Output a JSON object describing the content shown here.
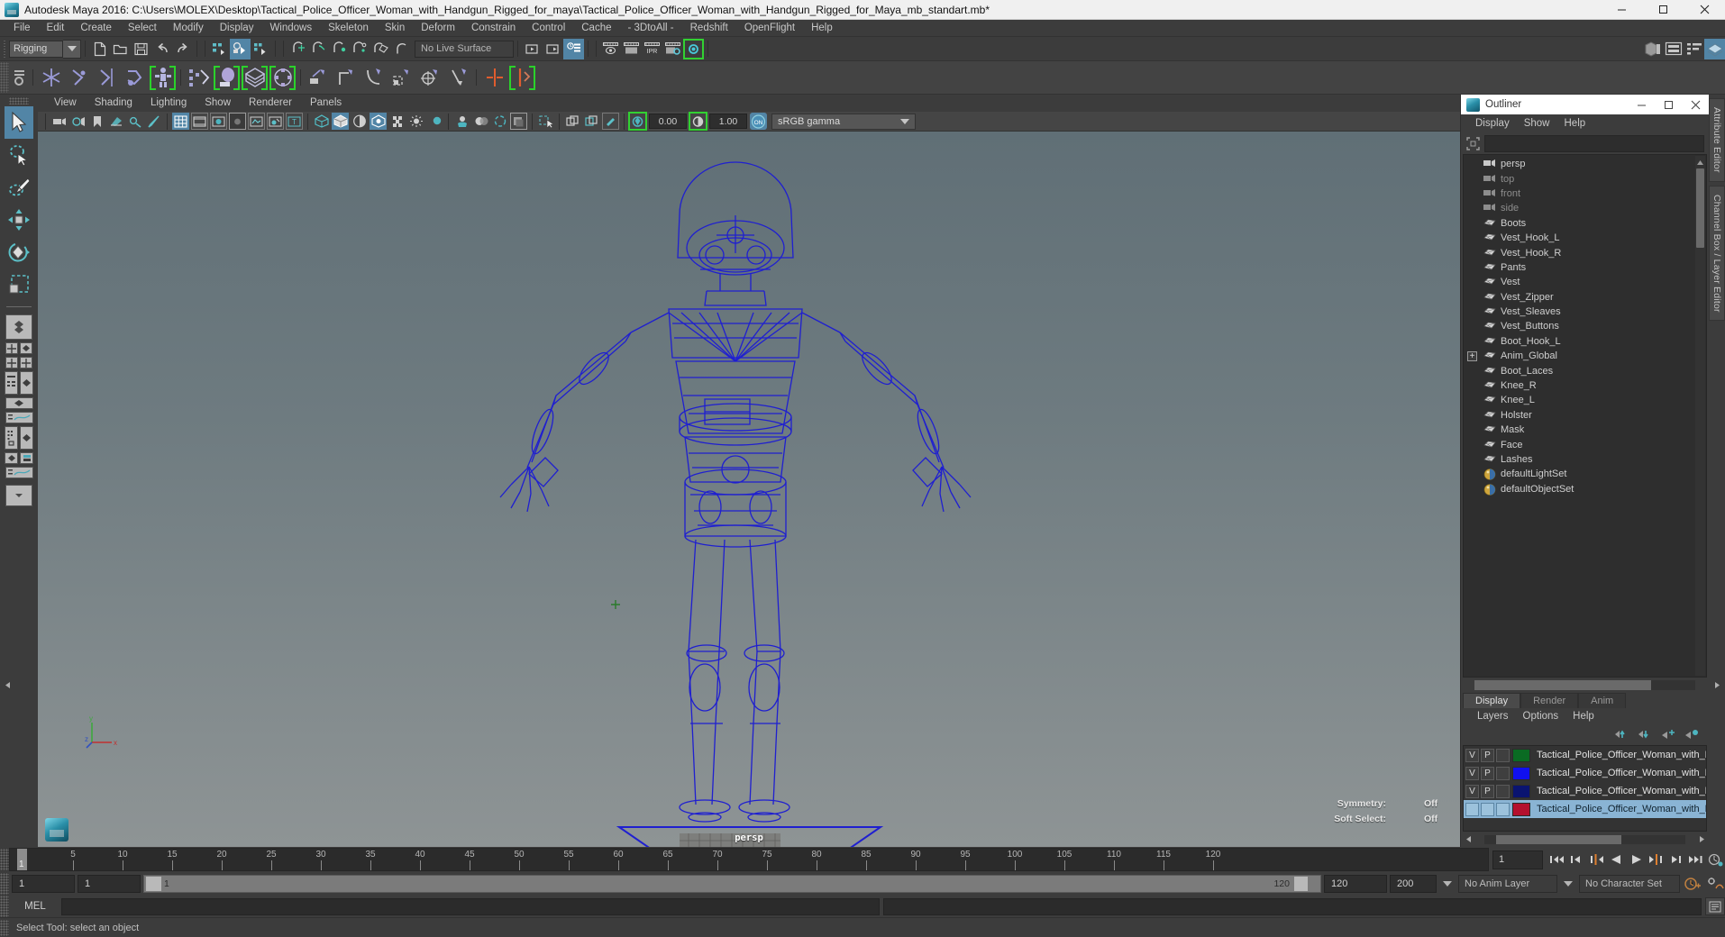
{
  "window": {
    "title": "Autodesk Maya 2016: C:\\Users\\MOLEX\\Desktop\\Tactical_Police_Officer_Woman_with_Handgun_Rigged_for_maya\\Tactical_Police_Officer_Woman_with_Handgun_Rigged_for_Maya_mb_standart.mb*",
    "minimize": "—",
    "maximize": "☐",
    "close": "✕"
  },
  "menubar": {
    "items": [
      "File",
      "Edit",
      "Create",
      "Select",
      "Modify",
      "Display",
      "Windows",
      "Skeleton",
      "Skin",
      "Deform",
      "Constrain",
      "Control",
      "Cache",
      "- 3DtoAll -",
      "Redshift",
      "OpenFlight",
      "Help"
    ]
  },
  "statusbar": {
    "menuset": "Rigging",
    "live_surface": "No Live Surface",
    "icons": [
      "new-scene-icon",
      "open-scene-icon",
      "save-scene-icon",
      "undo-icon",
      "redo-icon",
      "select-hierarchy-icon",
      "select-object-icon",
      "select-component-icon",
      "snap-grid-icon",
      "snap-curve-icon",
      "snap-point-icon",
      "snap-projected-icon",
      "snap-view-plane-icon",
      "make-live-icon",
      "open-editor-icon",
      "open-render-view-icon",
      "attribute-editor-toggle-icon",
      "render-current-frame-icon",
      "render-sequence-icon",
      "ipr-render-icon",
      "render-settings-icon",
      "toggle-render-region-icon",
      "show-channel-box-icon",
      "show-layer-editor-icon",
      "show-attribute-editor-icon",
      "show-tool-settings-icon"
    ]
  },
  "shelf": {
    "icons": [
      "joint-tool-icon",
      "ik-handle-tool-icon",
      "ik-spline-handle-icon",
      "insert-joint-tool-icon",
      "quick-rig-icon",
      "human-ik-icon",
      "bind-skin-icon",
      "interactive-bind-icon",
      "smooth-bind-icon",
      "parent-constraint-icon",
      "point-constraint-icon",
      "orient-constraint-icon",
      "scale-constraint-icon",
      "aim-constraint-icon",
      "pole-vector-constraint-icon",
      "mirror-joint-icon",
      "mirror-skin-weights-icon"
    ]
  },
  "toolbox": {
    "tools": [
      {
        "name": "select-tool",
        "selected": true
      },
      {
        "name": "lasso-select-tool",
        "selected": false
      },
      {
        "name": "paint-select-tool",
        "selected": false
      },
      {
        "name": "move-tool",
        "selected": false
      },
      {
        "name": "rotate-tool",
        "selected": false
      },
      {
        "name": "scale-tool",
        "selected": false
      }
    ],
    "layouts": [
      "single-perspective-layout",
      "four-view-layout",
      "outliner-persp-layout",
      "persp-graph-layout",
      "hypershade-persp-layout",
      "persp-graph-outliner-layout"
    ]
  },
  "viewport": {
    "menus": [
      "View",
      "Shading",
      "Lighting",
      "Show",
      "Renderer",
      "Panels"
    ],
    "exposure": "0.00",
    "gamma": "1.00",
    "color_management": "sRGB gamma",
    "camera_label": "persp",
    "hud": [
      {
        "label": "Symmetry:",
        "value": "Off"
      },
      {
        "label": "Soft Select:",
        "value": "Off"
      }
    ],
    "axes": {
      "y": "y",
      "x": "x",
      "z": "z"
    }
  },
  "outliner": {
    "title": "Outliner",
    "menus": [
      "Display",
      "Show",
      "Help"
    ],
    "search_value": "",
    "items": [
      {
        "label": "persp",
        "icon": "camera-icon",
        "type": "camera",
        "dim": false,
        "expandable": false
      },
      {
        "label": "top",
        "icon": "camera-icon",
        "type": "camera",
        "dim": true,
        "expandable": false
      },
      {
        "label": "front",
        "icon": "camera-icon",
        "type": "camera",
        "dim": true,
        "expandable": false
      },
      {
        "label": "side",
        "icon": "camera-icon",
        "type": "camera",
        "dim": true,
        "expandable": false
      },
      {
        "label": "Boots",
        "icon": "mesh-icon",
        "type": "mesh",
        "dim": false,
        "expandable": false
      },
      {
        "label": "Vest_Hook_L",
        "icon": "mesh-icon",
        "type": "mesh",
        "dim": false,
        "expandable": false
      },
      {
        "label": "Vest_Hook_R",
        "icon": "mesh-icon",
        "type": "mesh",
        "dim": false,
        "expandable": false
      },
      {
        "label": "Pants",
        "icon": "mesh-icon",
        "type": "mesh",
        "dim": false,
        "expandable": false
      },
      {
        "label": "Vest",
        "icon": "mesh-icon",
        "type": "mesh",
        "dim": false,
        "expandable": false
      },
      {
        "label": "Vest_Zipper",
        "icon": "mesh-icon",
        "type": "mesh",
        "dim": false,
        "expandable": false
      },
      {
        "label": "Vest_Sleaves",
        "icon": "mesh-icon",
        "type": "mesh",
        "dim": false,
        "expandable": false
      },
      {
        "label": "Vest_Buttons",
        "icon": "mesh-icon",
        "type": "mesh",
        "dim": false,
        "expandable": false
      },
      {
        "label": "Boot_Hook_L",
        "icon": "mesh-icon",
        "type": "mesh",
        "dim": false,
        "expandable": false
      },
      {
        "label": "Anim_Global",
        "icon": "mesh-icon",
        "type": "mesh",
        "dim": false,
        "expandable": true
      },
      {
        "label": "Boot_Laces",
        "icon": "mesh-icon",
        "type": "mesh",
        "dim": false,
        "expandable": false
      },
      {
        "label": "Knee_R",
        "icon": "mesh-icon",
        "type": "mesh",
        "dim": false,
        "expandable": false
      },
      {
        "label": "Knee_L",
        "icon": "mesh-icon",
        "type": "mesh",
        "dim": false,
        "expandable": false
      },
      {
        "label": "Holster",
        "icon": "mesh-icon",
        "type": "mesh",
        "dim": false,
        "expandable": false
      },
      {
        "label": "Mask",
        "icon": "mesh-icon",
        "type": "mesh",
        "dim": false,
        "expandable": false
      },
      {
        "label": "Face",
        "icon": "mesh-icon",
        "type": "mesh",
        "dim": false,
        "expandable": false
      },
      {
        "label": "Lashes",
        "icon": "mesh-icon",
        "type": "mesh",
        "dim": false,
        "expandable": false
      },
      {
        "label": "defaultLightSet",
        "icon": "set-icon",
        "type": "set",
        "dim": false,
        "expandable": false
      },
      {
        "label": "defaultObjectSet",
        "icon": "set-icon",
        "type": "set",
        "dim": false,
        "expandable": false
      }
    ]
  },
  "layer_editor": {
    "tabs": [
      {
        "label": "Display",
        "active": true
      },
      {
        "label": "Render",
        "active": false
      },
      {
        "label": "Anim",
        "active": false
      }
    ],
    "menus": [
      "Layers",
      "Options",
      "Help"
    ],
    "buttons": [
      "move-layer-up-icon",
      "move-layer-down-icon",
      "new-layer-icon",
      "new-layer-from-selected-icon"
    ],
    "layers": [
      {
        "v": "V",
        "p": "P",
        "t": "",
        "color": "#0a6b23",
        "name": "Tactical_Police_Officer_Woman_with_H",
        "selected": false
      },
      {
        "v": "V",
        "p": "P",
        "t": "",
        "color": "#1010ef",
        "name": "Tactical_Police_Officer_Woman_with_H",
        "selected": false
      },
      {
        "v": "V",
        "p": "P",
        "t": "",
        "color": "#0a1470",
        "name": "Tactical_Police_Officer_Woman_with_H",
        "selected": false
      },
      {
        "v": "",
        "p": "",
        "t": "",
        "color": "#b4102e",
        "name": "Tactical_Police_Officer_Woman_with_H",
        "selected": true
      }
    ]
  },
  "side_tabs": [
    "Attribute Editor",
    "Channel Box / Layer Editor"
  ],
  "timeline": {
    "labels": [
      "5",
      "10",
      "15",
      "20",
      "25",
      "30",
      "35",
      "40",
      "45",
      "50",
      "55",
      "60",
      "65",
      "70",
      "75",
      "80",
      "85",
      "90",
      "95",
      "100",
      "105",
      "110",
      "115",
      "120"
    ],
    "start": 1,
    "end": 120,
    "current_frame": "1",
    "current_field": "1",
    "playback_buttons": [
      "go-to-start-icon",
      "step-back-keyframe-icon",
      "step-back-frame-icon",
      "play-backwards-icon",
      "play-forwards-icon",
      "step-forward-frame-icon",
      "step-forward-keyframe-icon",
      "go-to-end-icon"
    ]
  },
  "range": {
    "anim_start": "1",
    "range_start": "1",
    "slider_start_label": "1",
    "slider_end_label": "120",
    "range_end": "120",
    "anim_end": "200",
    "anim_layer": "No Anim Layer",
    "character_set": "No Character Set",
    "right_icons": [
      "auto-keyframe-icon",
      "animation-preferences-icon"
    ]
  },
  "command_line": {
    "language": "MEL",
    "input_value": "",
    "output_value": "",
    "script_editor_icon": "script-editor-icon"
  },
  "help_line": {
    "text": "Select Tool: select an object"
  },
  "colors": {
    "accent": "#5285a6",
    "rig_wire": "#1f1fd0",
    "viewport_top": "#606f76",
    "viewport_bottom": "#8e9495",
    "panel_bg": "#3c3c3c",
    "green_highlight": "#32d132"
  }
}
